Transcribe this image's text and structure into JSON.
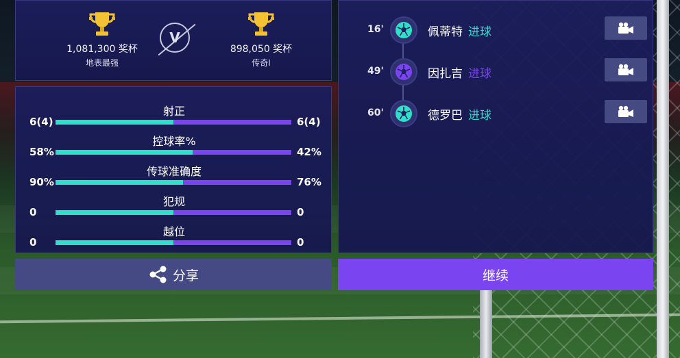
{
  "match": {
    "home": {
      "trophies": "1,081,300 奖杯",
      "rank": "地表最强"
    },
    "away": {
      "trophies": "898,050 奖杯",
      "rank": "传奇I"
    },
    "vs_label": "V"
  },
  "stats": [
    {
      "title": "射正",
      "home_display": "6(4)",
      "away_display": "6(4)",
      "home_share": 0.5
    },
    {
      "title": "控球率%",
      "home_display": "58%",
      "away_display": "42%",
      "home_share": 0.58
    },
    {
      "title": "传球准确度",
      "home_display": "90%",
      "away_display": "76%",
      "home_share": 0.5421
    },
    {
      "title": "犯规",
      "home_display": "0",
      "away_display": "0",
      "home_share": 0.5
    },
    {
      "title": "越位",
      "home_display": "0",
      "away_display": "0",
      "home_share": 0.5
    }
  ],
  "events": [
    {
      "minute": "16'",
      "player": "佩蒂特",
      "type": "进球",
      "team": "home"
    },
    {
      "minute": "49'",
      "player": "因扎吉",
      "type": "进球",
      "team": "away"
    },
    {
      "minute": "60'",
      "player": "德罗巴",
      "type": "进球",
      "team": "home"
    }
  ],
  "buttons": {
    "share_label": "分享",
    "continue_label": "继续"
  },
  "colors": {
    "home": "#2fe0c8",
    "away": "#7a45f0",
    "panel": "#1c1f5e",
    "button_secondary": "#464a84",
    "button_primary": "#7a45f0"
  },
  "icons": {
    "trophy": "trophy-icon",
    "ball": "soccer-ball-icon",
    "camera": "video-camera-icon",
    "share": "share-icon"
  }
}
